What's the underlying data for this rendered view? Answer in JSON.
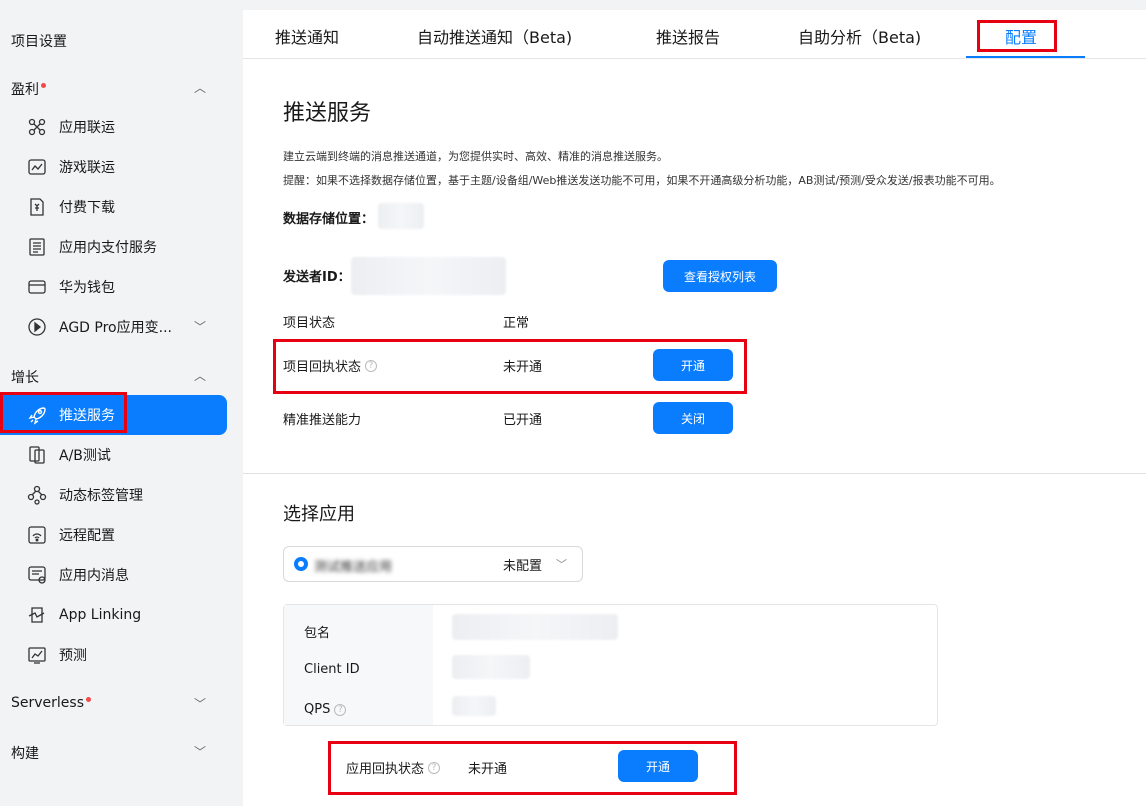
{
  "sidebar": {
    "project_settings": "项目设置",
    "groups": {
      "monetize": "盈利",
      "growth": "增长",
      "serverless": "Serverless",
      "build": "构建"
    },
    "monetize_items": [
      {
        "label": "应用联运",
        "icon": "app-joint-operation-icon"
      },
      {
        "label": "游戏联运",
        "icon": "game-joint-operation-icon"
      },
      {
        "label": "付费下载",
        "icon": "paid-download-icon"
      },
      {
        "label": "应用内支付服务",
        "icon": "in-app-purchase-icon"
      },
      {
        "label": "华为钱包",
        "icon": "wallet-icon"
      },
      {
        "label": "AGD Pro应用变...",
        "icon": "play-circle-icon"
      }
    ],
    "growth_items": [
      {
        "label": "推送服务",
        "icon": "rocket-icon"
      },
      {
        "label": "A/B测试",
        "icon": "ab-test-icon"
      },
      {
        "label": "动态标签管理",
        "icon": "dynamic-tag-icon"
      },
      {
        "label": "远程配置",
        "icon": "remote-config-icon"
      },
      {
        "label": "应用内消息",
        "icon": "in-app-message-icon"
      },
      {
        "label": "App Linking",
        "icon": "app-linking-icon"
      },
      {
        "label": "预测",
        "icon": "prediction-icon"
      }
    ]
  },
  "tabs": [
    "推送通知",
    "自动推送通知（Beta)",
    "推送报告",
    "自助分析（Beta)",
    "配置"
  ],
  "push": {
    "title": "推送服务",
    "desc1": "建立云端到终端的消息推送通道，为您提供实时、高效、精准的消息推送服务。",
    "desc2": "提醒：如果不选择数据存储位置，基于主题/设备组/Web推送发送功能不可用，如果不开通高级分析功能，AB测试/预测/受众发送/报表功能不可用。",
    "storage_label": "数据存储位置：",
    "sender_label": "发送者ID：",
    "view_auth_button": "查看授权列表",
    "project_status_label": "项目状态",
    "project_status_value": "正常",
    "receipt_label": "项目回执状态",
    "receipt_value": "未开通",
    "receipt_button": "开通",
    "precise_label": "精准推送能力",
    "precise_value": "已开通",
    "precise_button": "关闭"
  },
  "app_select": {
    "title": "选择应用",
    "selected_app": "测试推送应用",
    "selected_status": "未配置",
    "package_label": "包名",
    "client_id_label": "Client ID",
    "qps_label": "QPS",
    "receipt_label": "应用回执状态",
    "receipt_value": "未开通",
    "receipt_button": "开通"
  },
  "colors": {
    "accent": "#0a7dff",
    "highlight": "#e60012",
    "dot": "#f04a4a"
  }
}
